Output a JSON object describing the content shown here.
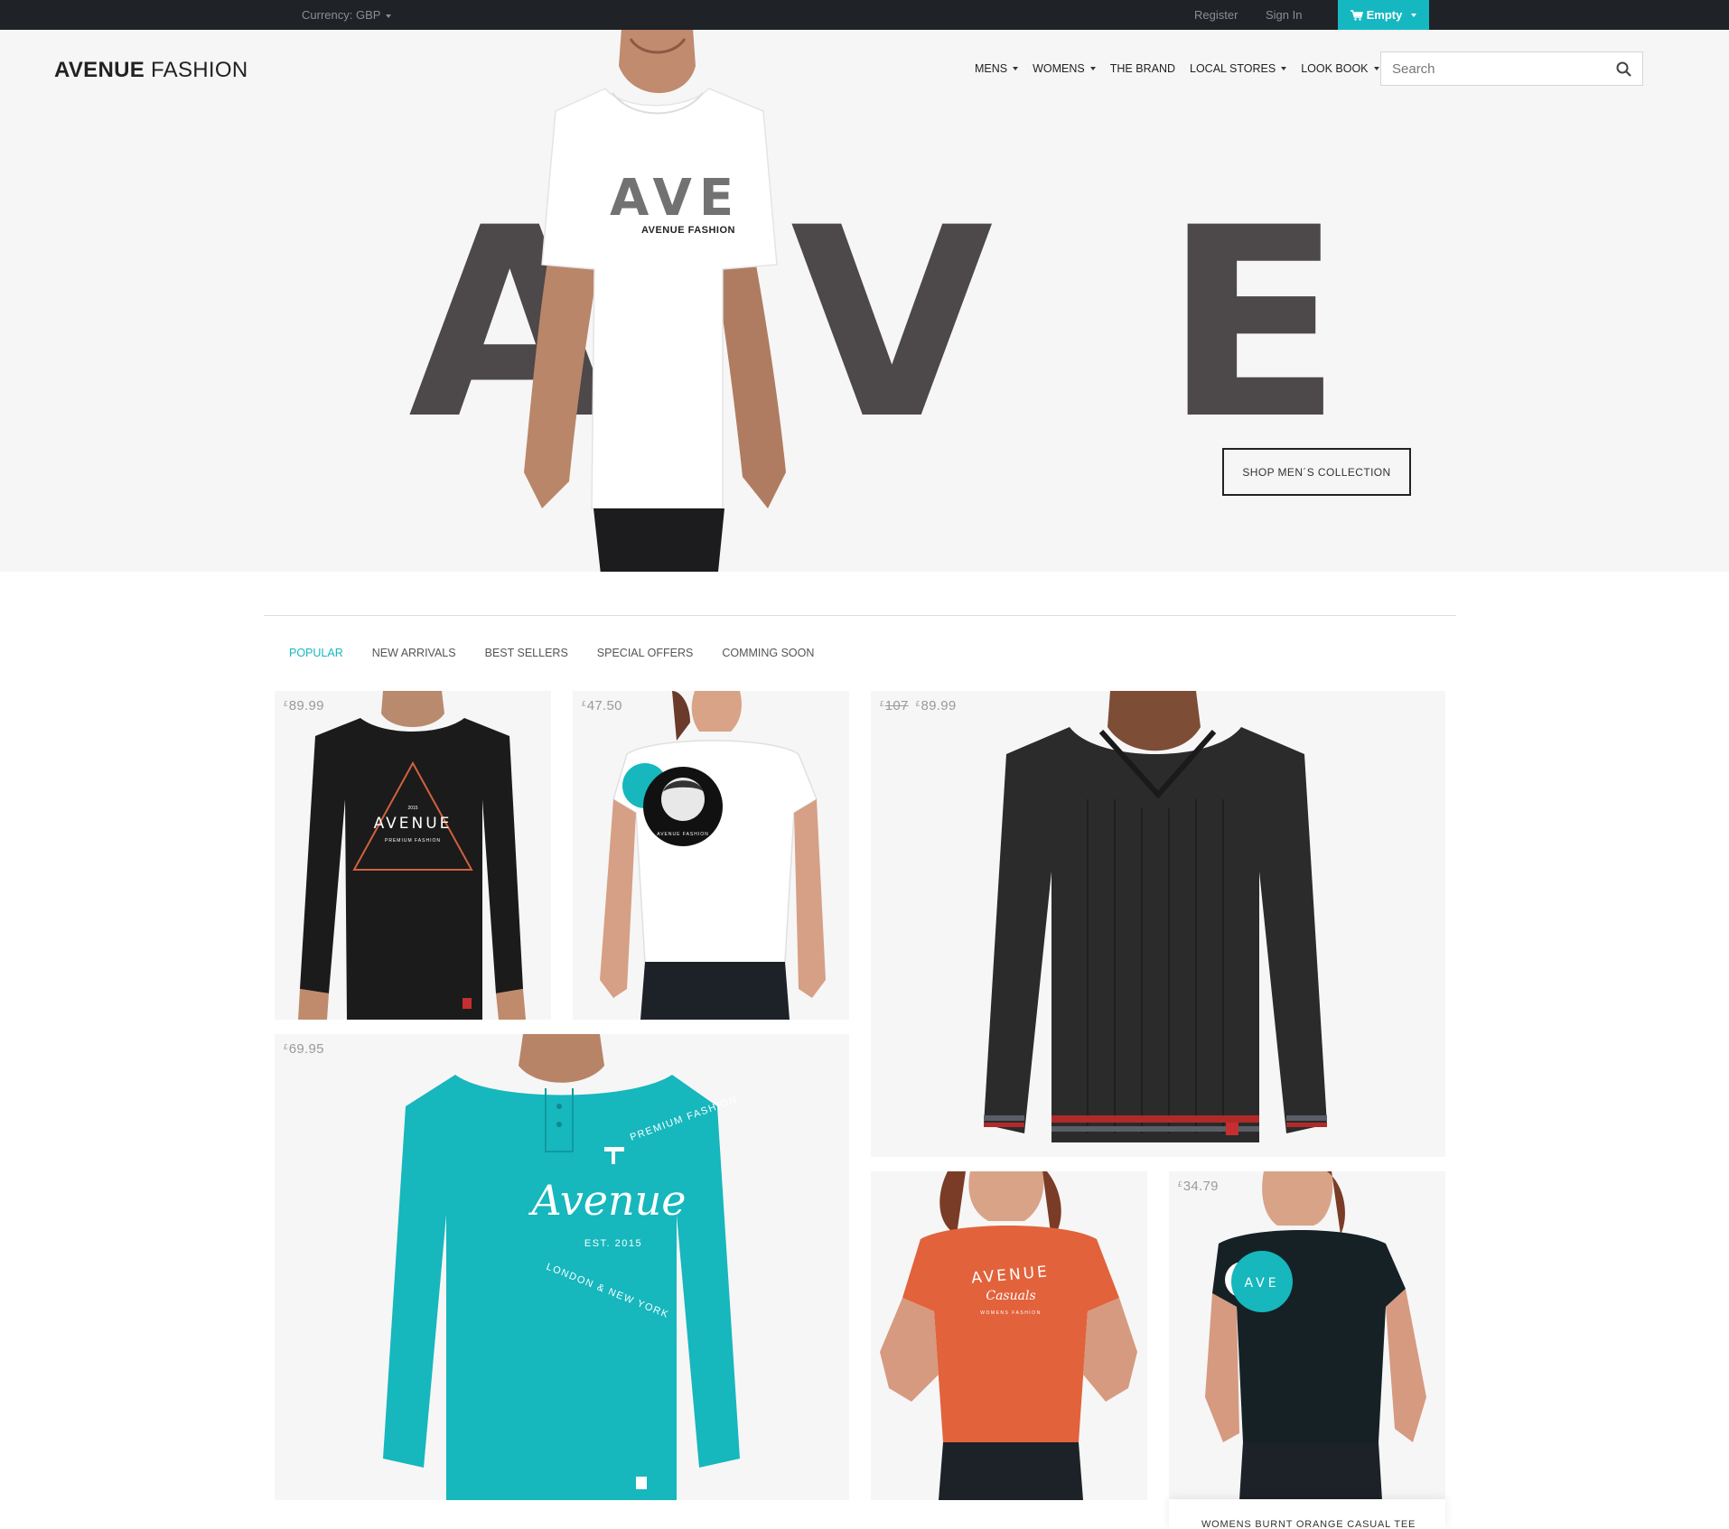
{
  "topbar": {
    "currency": "Currency: GBP",
    "register": "Register",
    "signin": "Sign In",
    "cart": "Empty"
  },
  "header": {
    "logo_bold": "AVENUE",
    "logo_light": "FASHION",
    "nav": [
      {
        "label": "MENS",
        "dropdown": true
      },
      {
        "label": "WOMENS",
        "dropdown": true
      },
      {
        "label": "THE BRAND",
        "dropdown": false
      },
      {
        "label": "LOCAL STORES",
        "dropdown": true
      },
      {
        "label": "LOOK BOOK",
        "dropdown": true
      }
    ],
    "search_placeholder": "Search"
  },
  "hero": {
    "letters": [
      "A",
      "V",
      "E"
    ],
    "tshirt_print": "AVE",
    "tshirt_subprint": "AVENUE FASHION",
    "cta": "SHOP MEN´S COLLECTION"
  },
  "tabs": [
    {
      "label": "POPULAR",
      "active": true
    },
    {
      "label": "NEW ARRIVALS",
      "active": false
    },
    {
      "label": "BEST SELLERS",
      "active": false
    },
    {
      "label": "SPECIAL OFFERS",
      "active": false
    },
    {
      "label": "COMMING SOON",
      "active": false
    }
  ],
  "products": [
    {
      "currency": "£",
      "price": "89.99",
      "old_price": "",
      "print": "AVENUE",
      "subprint": "PREMIUM FASHION",
      "year": "2015",
      "color": "#1b1b1b"
    },
    {
      "currency": "£",
      "price": "47.50",
      "old_price": "",
      "print": "AVENUE FASHION",
      "color": "#ffffff"
    },
    {
      "currency": "£",
      "price": "89.99",
      "old_price": "107",
      "color": "#2a2a2a"
    },
    {
      "currency": "£",
      "price": "69.95",
      "old_price": "",
      "print": "Avenue",
      "subprint": "PREMIUM FASHION",
      "est": "EST. 2015",
      "city": "LONDON & NEW YORK",
      "color": "#16b7bd"
    },
    {
      "currency": "",
      "price": "",
      "old_price": "",
      "print": "AVENUE",
      "subprint": "Casuals",
      "tagline": "WOMENS FASHION",
      "color": "#e2623c"
    },
    {
      "currency": "£",
      "price": "34.79",
      "old_price": "",
      "print": "AVE",
      "color": "#162126"
    }
  ],
  "caption": "WOMENS BURNT ORANGE CASUAL TEE",
  "colors": {
    "accent": "#15b8c1",
    "topbar": "#1f2226",
    "hero_letters": "#4d4849"
  }
}
